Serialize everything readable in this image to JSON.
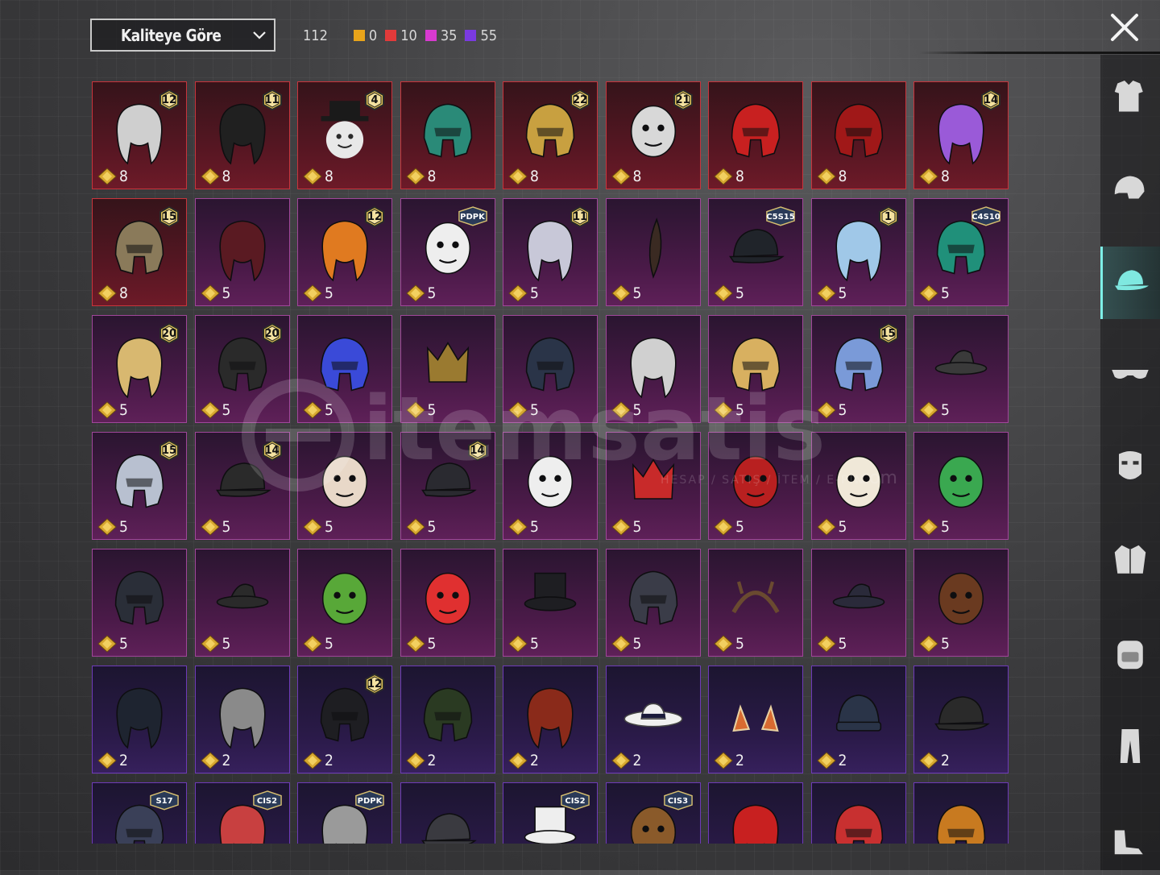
{
  "sort": {
    "label": "Kaliteye Göre"
  },
  "counts": {
    "total": "112",
    "chips": [
      {
        "color": "#e8a41a",
        "value": "0"
      },
      {
        "color": "#e23a3a",
        "value": "10"
      },
      {
        "color": "#d83ad0",
        "value": "35"
      },
      {
        "color": "#7a3ae0",
        "value": "55"
      }
    ]
  },
  "watermark": {
    "brand": "itemsatis",
    "sub": "HESAP / SATIŞ / İTEM / E-PİN",
    "tld": ".com"
  },
  "sidebar": {
    "categories": [
      {
        "name": "outfit",
        "icon": "outfit-icon",
        "active": false
      },
      {
        "name": "helmet",
        "icon": "helmet-icon",
        "active": false
      },
      {
        "name": "hat",
        "icon": "cap-icon",
        "active": true
      },
      {
        "name": "glasses",
        "icon": "glasses-icon",
        "active": false
      },
      {
        "name": "mask",
        "icon": "mask-icon",
        "active": false
      },
      {
        "name": "jacket",
        "icon": "jacket-icon",
        "active": false
      },
      {
        "name": "backpack",
        "icon": "backpack-icon",
        "active": false
      },
      {
        "name": "pants",
        "icon": "pants-icon",
        "active": false
      },
      {
        "name": "shoes",
        "icon": "shoes-icon",
        "active": false
      }
    ]
  },
  "grid": {
    "rows": [
      [
        {
          "q": "8",
          "badge": "12",
          "tier": "red",
          "c": "#cfcfcf",
          "s": "hair"
        },
        {
          "q": "8",
          "badge": "11",
          "tier": "red",
          "c": "#202020",
          "s": "hair"
        },
        {
          "q": "8",
          "badge": "4",
          "tier": "red",
          "c": "#e8e8e8",
          "s": "snow"
        },
        {
          "q": "8",
          "badge": "",
          "tier": "red",
          "c": "#2a8a78",
          "s": "helm"
        },
        {
          "q": "8",
          "badge": "22",
          "tier": "red",
          "c": "#c8a040",
          "s": "helm"
        },
        {
          "q": "8",
          "badge": "21",
          "tier": "red",
          "c": "#d8d8d8",
          "s": "face"
        },
        {
          "q": "8",
          "badge": "",
          "tier": "red",
          "c": "#c82020",
          "s": "helm"
        },
        {
          "q": "8",
          "badge": "",
          "tier": "red",
          "c": "#a01818",
          "s": "helm"
        },
        {
          "q": "8",
          "badge": "14",
          "tier": "red",
          "c": "#9a5ad8",
          "s": "hair"
        }
      ],
      [
        {
          "q": "8",
          "badge": "15",
          "tier": "red",
          "c": "#8a7a5a",
          "s": "helm"
        },
        {
          "q": "5",
          "badge": "",
          "tier": "purple",
          "c": "#5a1a22",
          "s": "hair"
        },
        {
          "q": "5",
          "badge": "12",
          "tier": "purple",
          "c": "#e07a20",
          "s": "hair"
        },
        {
          "q": "5",
          "badge": "PDPK",
          "tier": "purple",
          "c": "#eeeeee",
          "s": "face"
        },
        {
          "q": "5",
          "badge": "11",
          "tier": "purple",
          "c": "#c8c8d8",
          "s": "hair"
        },
        {
          "q": "5",
          "badge": "",
          "tier": "purple",
          "c": "#3a2a22",
          "s": "feather"
        },
        {
          "q": "5",
          "badge": "C5S15",
          "tier": "purple",
          "c": "#20242a",
          "s": "cap"
        },
        {
          "q": "5",
          "badge": "1",
          "tier": "purple",
          "c": "#a0c8e8",
          "s": "hair"
        },
        {
          "q": "5",
          "badge": "C4S10",
          "tier": "purple",
          "c": "#20907a",
          "s": "helm"
        }
      ],
      [
        {
          "q": "5",
          "badge": "20",
          "tier": "purple",
          "c": "#d8b870",
          "s": "hair"
        },
        {
          "q": "5",
          "badge": "20",
          "tier": "purple",
          "c": "#2a2a2a",
          "s": "helm"
        },
        {
          "q": "5",
          "badge": "",
          "tier": "purple",
          "c": "#3a4ad8",
          "s": "helm"
        },
        {
          "q": "5",
          "badge": "",
          "tier": "purple",
          "c": "#9a7a30",
          "s": "crown"
        },
        {
          "q": "5",
          "badge": "",
          "tier": "purple",
          "c": "#2a3448",
          "s": "helm"
        },
        {
          "q": "5",
          "badge": "",
          "tier": "purple",
          "c": "#d0d0d0",
          "s": "hair"
        },
        {
          "q": "5",
          "badge": "",
          "tier": "purple",
          "c": "#d8b060",
          "s": "helm"
        },
        {
          "q": "5",
          "badge": "15",
          "tier": "purple",
          "c": "#7a9ad8",
          "s": "helm"
        },
        {
          "q": "5",
          "badge": "",
          "tier": "purple",
          "c": "#3a3a3a",
          "s": "hat"
        }
      ],
      [
        {
          "q": "5",
          "badge": "15",
          "tier": "purple",
          "c": "#b8c0d0",
          "s": "helm"
        },
        {
          "q": "5",
          "badge": "14",
          "tier": "purple",
          "c": "#2a2a2a",
          "s": "cap"
        },
        {
          "q": "5",
          "badge": "",
          "tier": "purple",
          "c": "#e8d8c8",
          "s": "face"
        },
        {
          "q": "5",
          "badge": "14",
          "tier": "purple",
          "c": "#2a2a30",
          "s": "cap"
        },
        {
          "q": "5",
          "badge": "",
          "tier": "purple",
          "c": "#eeeeee",
          "s": "face"
        },
        {
          "q": "5",
          "badge": "",
          "tier": "purple",
          "c": "#c82a2a",
          "s": "crown"
        },
        {
          "q": "5",
          "badge": "",
          "tier": "purple",
          "c": "#b82020",
          "s": "face"
        },
        {
          "q": "5",
          "badge": "",
          "tier": "purple",
          "c": "#f0e8d8",
          "s": "face"
        },
        {
          "q": "5",
          "badge": "",
          "tier": "purple",
          "c": "#3aa850",
          "s": "face"
        }
      ],
      [
        {
          "q": "5",
          "badge": "",
          "tier": "purple",
          "c": "#2a2e38",
          "s": "helm"
        },
        {
          "q": "5",
          "badge": "",
          "tier": "purple",
          "c": "#2a2a2a",
          "s": "hat"
        },
        {
          "q": "5",
          "badge": "",
          "tier": "purple",
          "c": "#58a838",
          "s": "face"
        },
        {
          "q": "5",
          "badge": "",
          "tier": "purple",
          "c": "#e03030",
          "s": "face"
        },
        {
          "q": "5",
          "badge": "",
          "tier": "purple",
          "c": "#1e1e22",
          "s": "tophat"
        },
        {
          "q": "5",
          "badge": "",
          "tier": "purple",
          "c": "#3a3c48",
          "s": "helm"
        },
        {
          "q": "5",
          "badge": "",
          "tier": "purple",
          "c": "#6a4a30",
          "s": "band"
        },
        {
          "q": "5",
          "badge": "",
          "tier": "purple",
          "c": "#2a2a3a",
          "s": "hat"
        },
        {
          "q": "5",
          "badge": "",
          "tier": "purple",
          "c": "#6a3a20",
          "s": "face"
        }
      ],
      [
        {
          "q": "2",
          "badge": "",
          "tier": "violet",
          "c": "#1e2430",
          "s": "hair"
        },
        {
          "q": "2",
          "badge": "",
          "tier": "violet",
          "c": "#8a8a8a",
          "s": "hair"
        },
        {
          "q": "2",
          "badge": "12",
          "tier": "violet",
          "c": "#1e1e22",
          "s": "helm"
        },
        {
          "q": "2",
          "badge": "",
          "tier": "violet",
          "c": "#2a3a22",
          "s": "helm"
        },
        {
          "q": "2",
          "badge": "",
          "tier": "violet",
          "c": "#8a2a1a",
          "s": "hair"
        },
        {
          "q": "2",
          "badge": "",
          "tier": "violet",
          "c": "#f0f0f0",
          "s": "sunhat"
        },
        {
          "q": "2",
          "badge": "",
          "tier": "violet",
          "c": "#d86a30",
          "s": "horns"
        },
        {
          "q": "2",
          "badge": "",
          "tier": "violet",
          "c": "#2a3448",
          "s": "beanie"
        },
        {
          "q": "2",
          "badge": "",
          "tier": "violet",
          "c": "#2a2a2a",
          "s": "cap"
        }
      ],
      [
        {
          "q": "",
          "badge": "S17",
          "tier": "violet",
          "c": "#3a4058",
          "s": "helm"
        },
        {
          "q": "",
          "badge": "CIS2",
          "tier": "violet",
          "c": "#c84040",
          "s": "hair"
        },
        {
          "q": "",
          "badge": "PDPK",
          "tier": "violet",
          "c": "#9a9a9a",
          "s": "hair"
        },
        {
          "q": "",
          "badge": "",
          "tier": "violet",
          "c": "#3a3a40",
          "s": "cap"
        },
        {
          "q": "",
          "badge": "CIS2",
          "tier": "violet",
          "c": "#eeeeee",
          "s": "tophat"
        },
        {
          "q": "",
          "badge": "CIS3",
          "tier": "violet",
          "c": "#8a5a2a",
          "s": "face"
        },
        {
          "q": "",
          "badge": "",
          "tier": "violet",
          "c": "#c82020",
          "s": "hair"
        },
        {
          "q": "",
          "badge": "",
          "tier": "violet",
          "c": "#c83030",
          "s": "helm"
        },
        {
          "q": "",
          "badge": "",
          "tier": "violet",
          "c": "#c87a20",
          "s": "helm"
        }
      ]
    ]
  }
}
